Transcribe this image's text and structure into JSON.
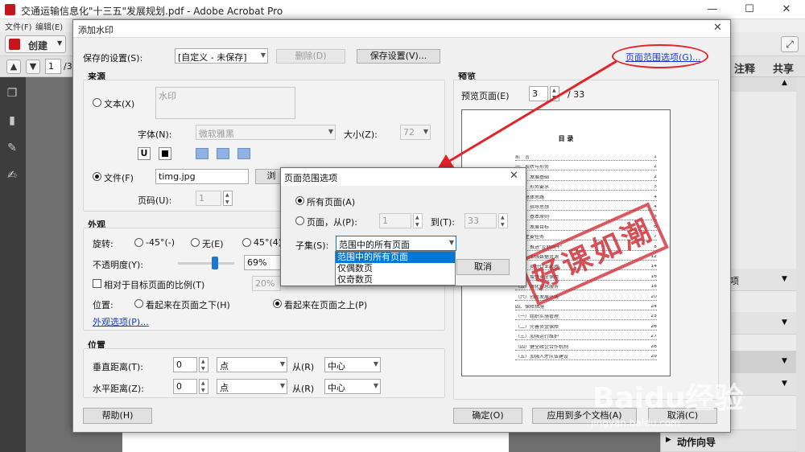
{
  "window": {
    "title": "交通运输信息化\"十三五\"发展规划.pdf - Adobe Acrobat Pro",
    "controls": [
      "—",
      "☐",
      "✕"
    ]
  },
  "menubar": [
    "文件(F)",
    "编辑(E)"
  ],
  "toolbar": {
    "create_label": "创建",
    "page_number": "1",
    "page_total": "/3"
  },
  "right_panel": {
    "comment_tab": "注释",
    "share_tab": "共享",
    "item_label": "项",
    "action_wizard": "动作向导"
  },
  "watermark_dialog": {
    "title": "添加水印",
    "saved_settings_label": "保存的设置(S):",
    "saved_settings_value": "[自定义 - 未保存]",
    "delete_button": "删除(D)",
    "save_settings_button": "保存设置(V)...",
    "page_range_link": "页面范围选项(G)...",
    "source": {
      "title": "来源",
      "text_radio": "文本(X)",
      "text_value": "水印",
      "font_label": "字体(N):",
      "font_value": "微软雅黑",
      "size_label": "大小(Z):",
      "size_value": "72",
      "file_radio": "文件(F)",
      "file_value": "timg.jpg",
      "browse_button": "浏",
      "page_code_label": "页码(U):",
      "page_code_value": "1"
    },
    "appearance": {
      "title": "外观",
      "rotate_label": "旋转:",
      "rot_minus45": "-45°(-)",
      "rot_none": "无(E)",
      "rot_45": "45°(4)",
      "opacity_label": "不透明度(Y):",
      "opacity_value": "69%",
      "relative_scale_label": "相对于目标页面的比例(T)",
      "relative_scale_value": "20%",
      "position_label": "位置:",
      "pos_below": "看起来在页面之下(H)",
      "pos_above": "看起来在页面之上(P)",
      "appearance_options_link": "外观选项(P)..."
    },
    "position": {
      "title": "位置",
      "vertical_label": "垂直距离(T):",
      "vertical_value": "0",
      "vertical_unit": "点",
      "from_label": "从(R)",
      "vertical_from": "中心",
      "horizontal_label": "水平距离(Z):",
      "horizontal_value": "0",
      "horizontal_unit": "点",
      "horizontal_from": "中心"
    },
    "preview": {
      "title": "预览",
      "page_label": "预览页面(E)",
      "page_value": "3",
      "page_total": "/ 33",
      "toc_title": "目 录",
      "toc": [
        {
          "text": "前　言",
          "page": "1"
        },
        {
          "text": "一、现状与形势",
          "page": "2"
        },
        {
          "text": "（一）发展基础",
          "page": "2"
        },
        {
          "text": "（二）形势要求",
          "page": "3"
        },
        {
          "text": "二、总体思路",
          "page": "4"
        },
        {
          "text": "（一）指导思想",
          "page": "4"
        },
        {
          "text": "（二）基本原则",
          "page": "5"
        },
        {
          "text": "（三）发展目标",
          "page": "6"
        },
        {
          "text": "三、主要任务",
          "page": "7"
        },
        {
          "text": "（一）推进\"互联网+\"",
          "page": "8"
        },
        {
          "text": "（二）加强数据资源",
          "page": "12"
        },
        {
          "text": "（三）提升行业治理",
          "page": "14"
        },
        {
          "text": "（四）增强安全保障",
          "page": "16"
        },
        {
          "text": "（五）强化信息服务",
          "page": "18"
        },
        {
          "text": "（六）创新发展环境",
          "page": "20"
        },
        {
          "text": "四、保障措施",
          "page": "24"
        },
        {
          "text": "（一）组织实施管理",
          "page": "25"
        },
        {
          "text": "（二）完善资金保障",
          "page": "26"
        },
        {
          "text": "（三）加强运行维护",
          "page": "27"
        },
        {
          "text": "（四）健全政企合作机制",
          "page": "28"
        },
        {
          "text": "（五）加强人才队伍建设",
          "page": "29"
        }
      ],
      "stamp_text": "好课如潮"
    },
    "help_button": "帮助(H)",
    "ok_button": "确定(O)",
    "apply_multi_button": "应用到多个文档(A)",
    "cancel_button": "取消(C)"
  },
  "page_range_dialog": {
    "title": "页面范围选项",
    "all_pages": "所有页面(A)",
    "pages_from": "页面，从(P):",
    "from_value": "1",
    "to_label": "到(T):",
    "to_value": "33",
    "subset_label": "子集(S):",
    "subset_value": "范围中的所有页面",
    "subset_options": [
      "范围中的所有页面",
      "仅偶数页",
      "仅奇数页"
    ],
    "cancel_button": "取消"
  },
  "watermark_overlay": {
    "brand": "Baidu经验",
    "url": "jingyan.baidu.com"
  },
  "colors": {
    "annotation_red": "#e0242a",
    "selection_blue": "#0078d7",
    "link_blue": "#1a37c9"
  }
}
